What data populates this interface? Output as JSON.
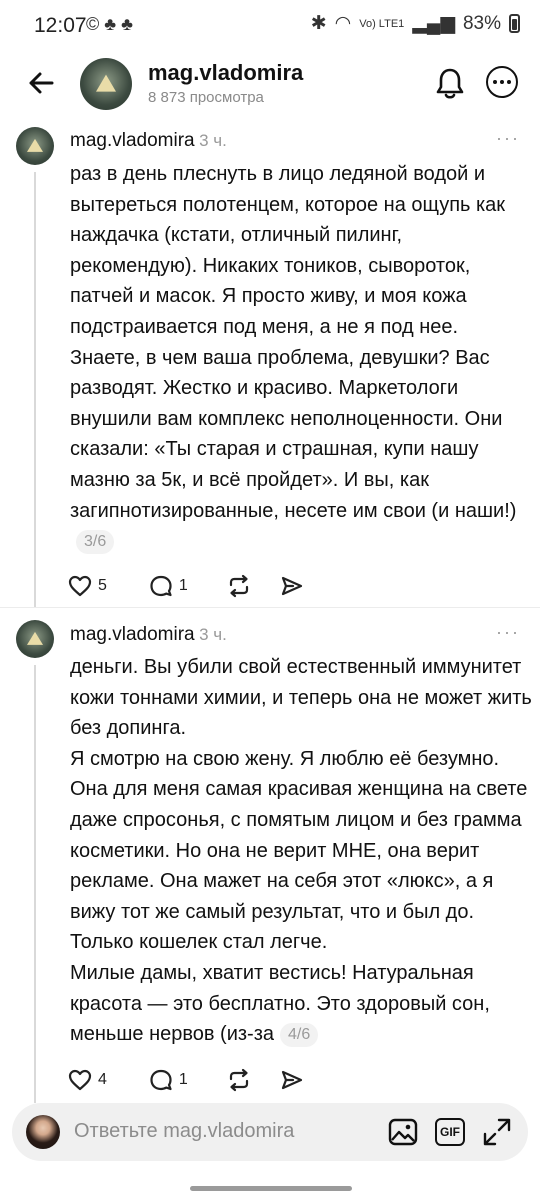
{
  "status_bar": {
    "time": "12:07",
    "left_icons": "© ♣ ♣",
    "network": "Vo) LTE1",
    "battery": "83%"
  },
  "header": {
    "title": "mag.vladomira",
    "subtitle": "8 873 просмотра"
  },
  "posts": [
    {
      "username": "mag.vladomira",
      "time": "3 ч.",
      "text": "раз в день плеснуть в лицо ледяной водой и вытереться полотенцем, которое на ощупь как наждачка (кстати, отличный пилинг, рекомендую). Никаких тоников, сывороток, патчей и масок. Я просто живу, и моя кожа подстраивается под меня, а не я под нее. Знаете, в чем ваша проблема, девушки? Вас разводят. Жестко и красиво. Маркетологи внушили вам комплекс неполноценности. Они сказали: «Ты старая и страшная, купи нашу мазню за 5к, и всё пройдет». И вы, как загипнотизированные, несете им свои (и наши!)",
      "counter": "3/6",
      "likes": "5",
      "replies": "1"
    },
    {
      "username": "mag.vladomira",
      "time": "3 ч.",
      "text": "деньги. Вы убили свой естественный иммунитет кожи тоннами химии, и теперь она не может жить без допинга.\nЯ смотрю на свою жену. Я люблю её безумно. Она для меня самая красивая женщина на свете даже спросонья, с помятым лицом и без грамма косметики. Но она не верит МНЕ, она верит рекламе. Она мажет на себя этот «люкс», а я вижу тот же самый результат, что и был до. Только кошелек стал легче.\nМилые дамы, хватит вестись! Натуральная красота — это бесплатно. Это здоровый сон, меньше нервов (из-за",
      "counter": "4/6",
      "likes": "4",
      "replies": "1"
    }
  ],
  "reply_bar": {
    "placeholder": "Ответьте mag.vladomira",
    "gif_label": "GIF"
  }
}
